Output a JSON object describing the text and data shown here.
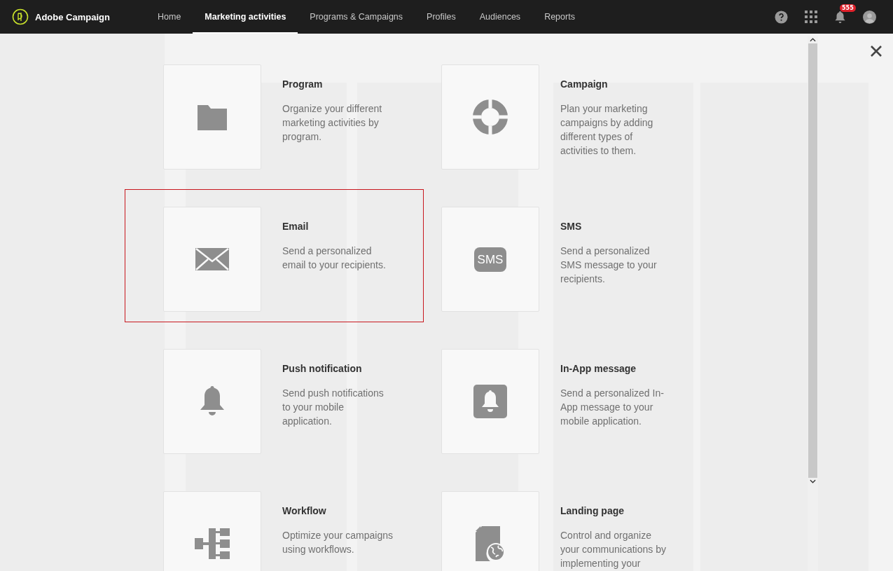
{
  "header": {
    "product": "Adobe Campaign",
    "nav": [
      {
        "label": "Home",
        "selected": false
      },
      {
        "label": "Marketing activities",
        "selected": true
      },
      {
        "label": "Programs & Campaigns",
        "selected": false
      },
      {
        "label": "Profiles",
        "selected": false
      },
      {
        "label": "Audiences",
        "selected": false
      },
      {
        "label": "Reports",
        "selected": false
      }
    ],
    "notification_count": "555"
  },
  "activity_types": [
    {
      "kind": "folder",
      "title": "Program",
      "description": "Organize your different marketing activities by program.",
      "selected": false
    },
    {
      "kind": "lifebuoy",
      "title": "Campaign",
      "description": "Plan your marketing campaigns by adding different types of activities to them.",
      "selected": false
    },
    {
      "kind": "envelope",
      "title": "Email",
      "description": "Send a personalized email to your recipients.",
      "selected": true
    },
    {
      "kind": "sms",
      "icon_text": "SMS",
      "title": "SMS",
      "description": "Send a personalized SMS message to your recipients.",
      "selected": false
    },
    {
      "kind": "bell",
      "title": "Push notification",
      "description": "Send push notifications to your mobile application.",
      "selected": false
    },
    {
      "kind": "bell-square",
      "title": "In-App message",
      "description": "Send a personalized In-App message to your mobile application.",
      "selected": false
    },
    {
      "kind": "workflow",
      "title": "Workflow",
      "description": "Optimize your campaigns using workflows.",
      "selected": false
    },
    {
      "kind": "page-globe",
      "title": "Landing page",
      "description": "Control and organize your communications by implementing your",
      "selected": false
    }
  ]
}
